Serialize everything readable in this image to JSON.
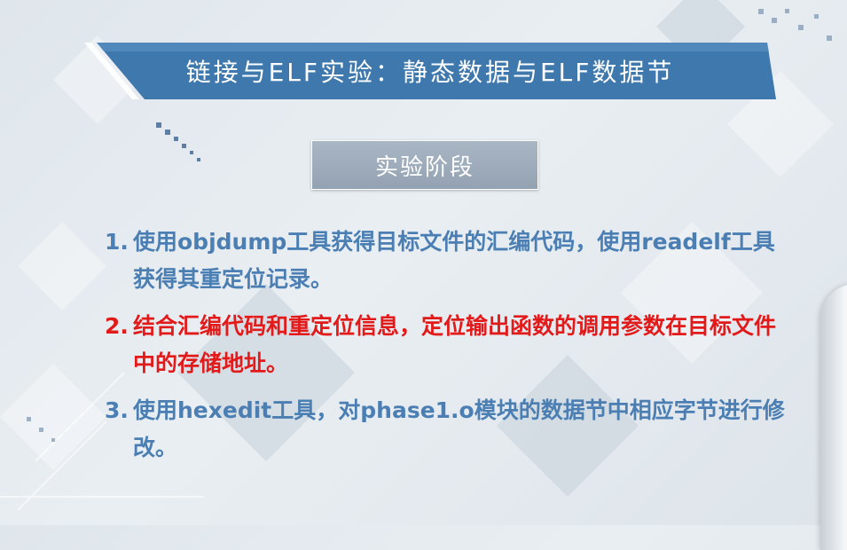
{
  "title": "链接与ELF实验：静态数据与ELF数据节",
  "stage_label": "实验阶段",
  "steps": [
    {
      "num": "1.",
      "text": "使用objdump工具获得目标文件的汇编代码，使用readelf工具获得其重定位记录。"
    },
    {
      "num": "2.",
      "text": "结合汇编代码和重定位信息，定位输出函数的调用参数在目标文件中的存储地址。"
    },
    {
      "num": "3.",
      "text": "使用hexedit工具，对phase1.o模块的数据节中相应字节进行修改。"
    }
  ],
  "colors": {
    "banner": "#3f78ad",
    "step_default": "#4b7fb3",
    "step_highlight": "#e31a1a",
    "stage_box": "#9eacbb"
  }
}
